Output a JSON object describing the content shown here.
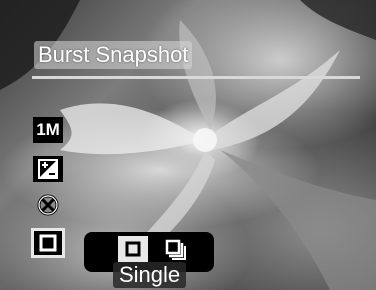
{
  "menu": {
    "title": "Burst Snapshot",
    "side_icons": [
      {
        "name": "resolution",
        "label": "1M"
      },
      {
        "name": "exposure-compensation",
        "label": ""
      },
      {
        "name": "flash-off",
        "label": ""
      },
      {
        "name": "drive-mode",
        "label": ""
      }
    ],
    "options": [
      {
        "name": "single",
        "selected": true
      },
      {
        "name": "burst",
        "selected": false
      }
    ],
    "selected_label": "Single"
  },
  "colors": {
    "highlight": "#e8e8e8",
    "box": "#000000"
  }
}
